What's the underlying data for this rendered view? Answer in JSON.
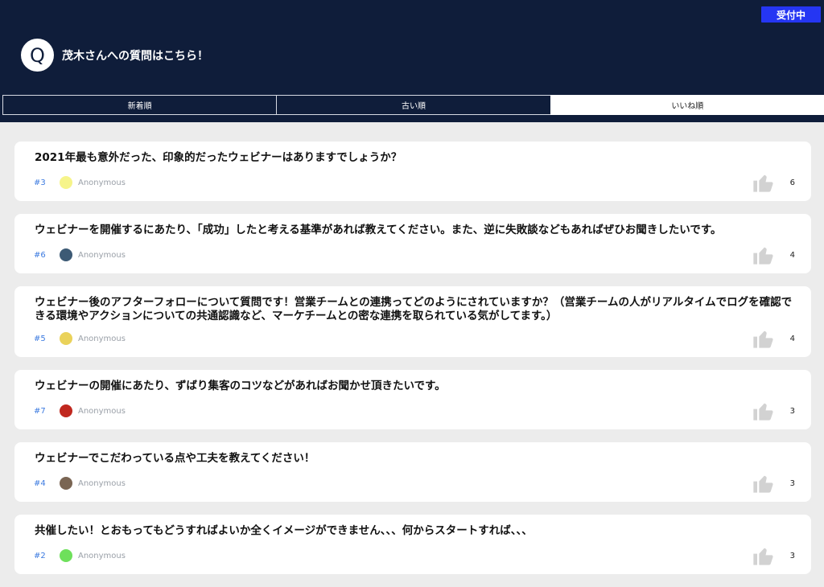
{
  "header": {
    "status": "受付中",
    "avatar_letter": "Q",
    "title": "茂木さんへの質問はこちら！"
  },
  "tabs": [
    {
      "label": "新着順",
      "active": false
    },
    {
      "label": "古い順",
      "active": false
    },
    {
      "label": "いいね順",
      "active": true
    }
  ],
  "questions": [
    {
      "text": "2021年最も意外だった、印象的だったウェビナーはありますでしょうか？",
      "number": "#3",
      "avatar_color": "#f6f48a",
      "author": "Anonymous",
      "likes": "6"
    },
    {
      "text": "ウェビナーを開催するにあたり、「成功」したと考える基準があれば教えてください。また、逆に失敗談などもあればぜひお聞きしたいです。",
      "number": "#6",
      "avatar_color": "#3d5a75",
      "author": "Anonymous",
      "likes": "4"
    },
    {
      "text": "ウェビナー後のアフターフォローについて質問です！営業チームとの連携ってどのようにされていますか？（営業チームの人がリアルタイムでログを確認できる環境やアクションについての共通認識など、マーケチームとの密な連携を取られている気がしてます。）",
      "number": "#5",
      "avatar_color": "#ead25a",
      "author": "Anonymous",
      "likes": "4"
    },
    {
      "text": "ウェビナーの開催にあたり、ずばり集客のコツなどがあればお聞かせ頂きたいです。",
      "number": "#7",
      "avatar_color": "#c0281f",
      "author": "Anonymous",
      "likes": "3"
    },
    {
      "text": "ウェビナーでこだわっている点や工夫を教えてください！",
      "number": "#4",
      "avatar_color": "#7a6553",
      "author": "Anonymous",
      "likes": "3"
    },
    {
      "text": "共催したい！とおもってもどうすればよいか全くイメージができません、、、何からスタートすれば、、、",
      "number": "#2",
      "avatar_color": "#6ee05b",
      "author": "Anonymous",
      "likes": "3"
    }
  ]
}
